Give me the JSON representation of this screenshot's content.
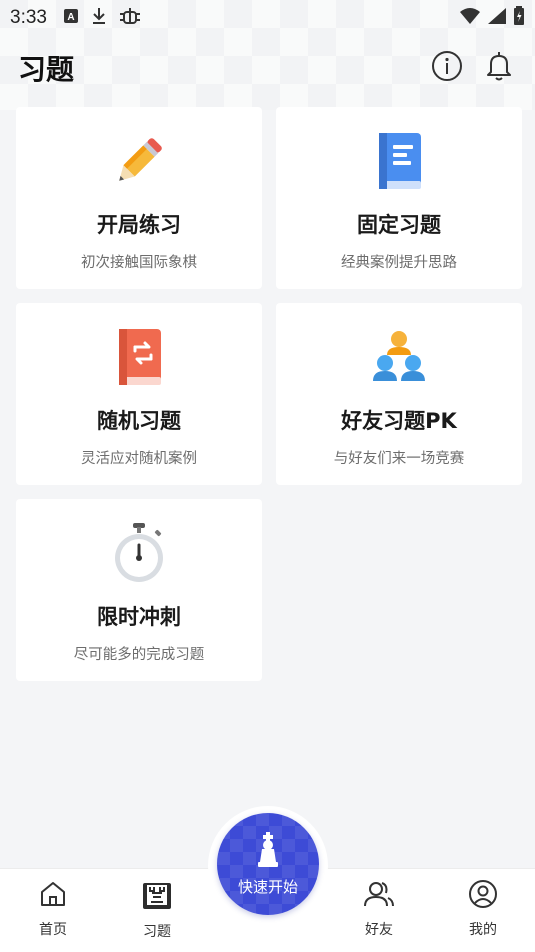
{
  "status_bar": {
    "time": "3:33",
    "icons": [
      "a-icon",
      "download-icon",
      "bug-icon",
      "wifi-icon",
      "signal-icon",
      "battery-icon"
    ]
  },
  "header": {
    "title": "习题",
    "actions": [
      "info-icon",
      "bell-icon"
    ]
  },
  "cards": [
    {
      "title": "开局练习",
      "subtitle": "初次接触国际象棋",
      "icon": "pencil-icon"
    },
    {
      "title": "固定习题",
      "subtitle": "经典案例提升思路",
      "icon": "book-icon"
    },
    {
      "title": "随机习题",
      "subtitle": "灵活应对随机案例",
      "icon": "shuffle-book-icon"
    },
    {
      "title": "好友习题PK",
      "subtitle": "与好友们来一场竞赛",
      "icon": "friends-icon"
    },
    {
      "title": "限时冲刺",
      "subtitle": "尽可能多的完成习题",
      "icon": "stopwatch-icon"
    }
  ],
  "tabbar": {
    "items": [
      {
        "label": "首页",
        "icon": "home-icon"
      },
      {
        "label": "习题",
        "icon": "exercise-icon",
        "active": true
      },
      {
        "label": "好友",
        "icon": "friends-tab-icon"
      },
      {
        "label": "我的",
        "icon": "profile-icon"
      }
    ],
    "fab_label": "快速开始",
    "fab_icon": "chess-king-icon"
  },
  "colors": {
    "accent": "#3d4bd6",
    "background": "#f4f5f7",
    "card": "#ffffff"
  }
}
